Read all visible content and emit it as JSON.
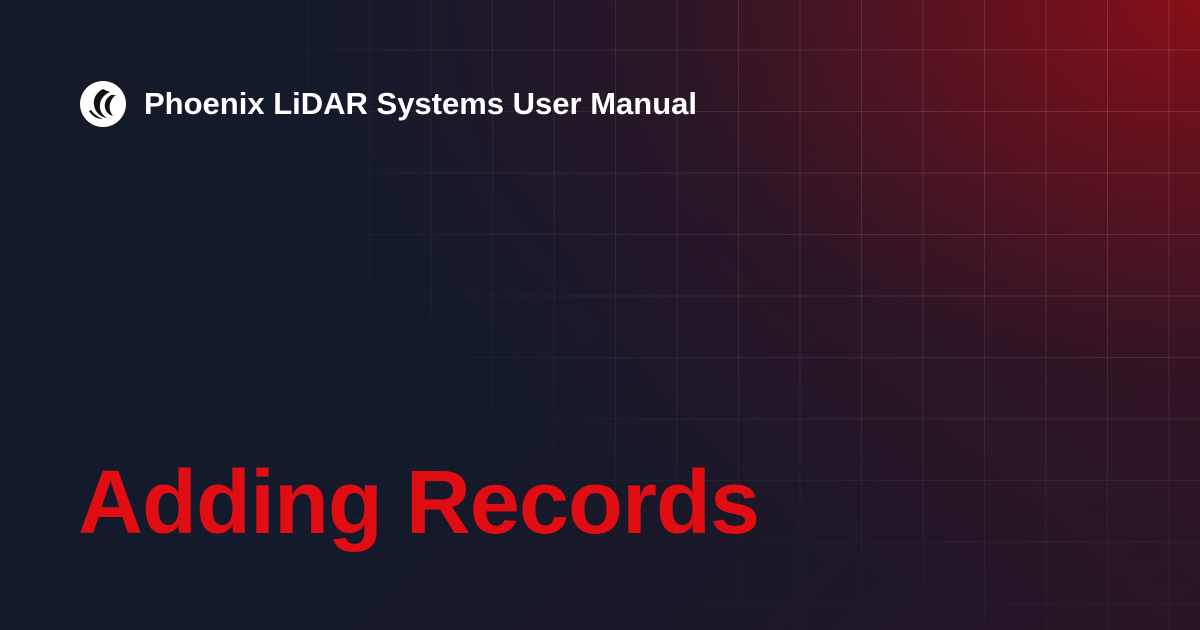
{
  "header": {
    "logo_icon": "phoenix-logo-icon",
    "site_title": "Phoenix LiDAR Systems User Manual"
  },
  "page": {
    "title": "Adding Records"
  },
  "colors": {
    "background": "#121a2b",
    "accent_glow": "#8c0e16",
    "title_text": "#e00d12",
    "header_text": "#ffffff"
  }
}
